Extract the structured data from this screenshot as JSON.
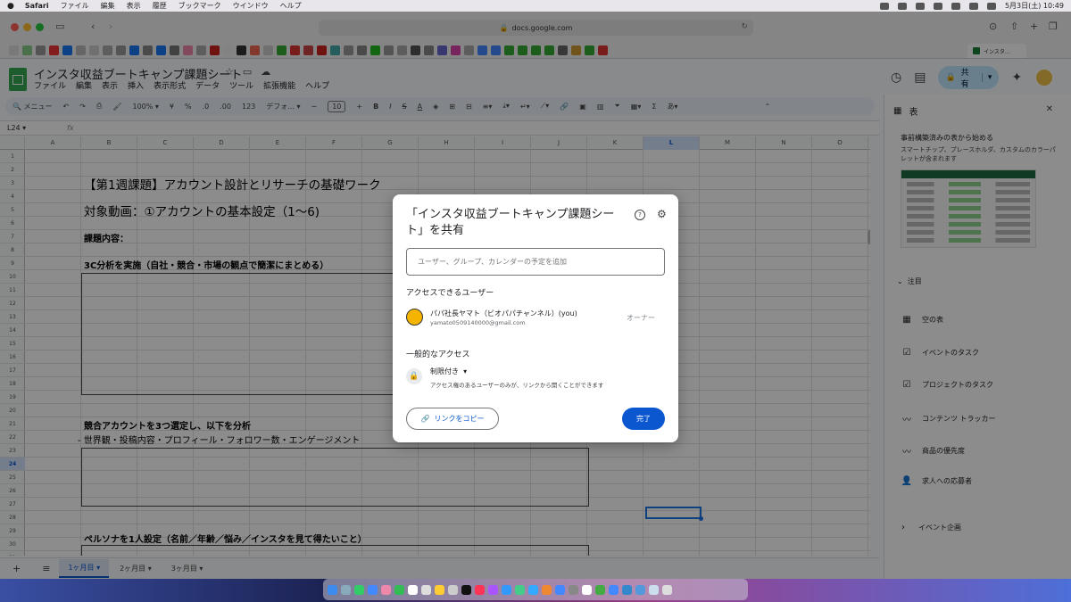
{
  "menubar": {
    "app": "Safari",
    "items": [
      "ファイル",
      "編集",
      "表示",
      "履歴",
      "ブックマーク",
      "ウインドウ",
      "ヘルプ"
    ],
    "datetime": "5月3日(土) 10:49"
  },
  "safari": {
    "url": "docs.google.com",
    "active_tab": "インスタ…"
  },
  "sheets": {
    "title": "インスタ収益ブートキャンプ課題シート",
    "menus": [
      "ファイル",
      "編集",
      "表示",
      "挿入",
      "表示形式",
      "データ",
      "ツール",
      "拡張機能",
      "ヘルプ"
    ],
    "share_label": "共有",
    "toolbar": {
      "menu": "メニュー",
      "zoom": "100%",
      "yen": "¥",
      "percent": "%",
      "dec_dec": ".0",
      "dec_inc": ".00",
      "num_fmt": "123",
      "font": "デフォ...",
      "font_size": "10"
    },
    "name_box": "L24",
    "fx": "fx",
    "columns": [
      "A",
      "B",
      "C",
      "D",
      "E",
      "F",
      "G",
      "H",
      "I",
      "J",
      "K",
      "L",
      "M",
      "N",
      "O"
    ],
    "selected_col": "L",
    "selected_row": "24",
    "rows": [
      "1",
      "2",
      "3",
      "4",
      "5",
      "6",
      "7",
      "8",
      "9",
      "10",
      "11",
      "12",
      "13",
      "14",
      "15",
      "16",
      "17",
      "18",
      "19",
      "20",
      "21",
      "22",
      "23",
      "24",
      "25",
      "26",
      "27",
      "28",
      "29",
      "30",
      "31"
    ],
    "cells": {
      "heading": "【第1週課題】アカウント設計とリサーチの基礎ワーク",
      "video": "対象動画：①アカウントの基本設定（1〜6)",
      "task": "課題内容：",
      "c3": "3C分析を実施（自社・競合・市場の観点で簡潔にまとめる）",
      "competitor": "競合アカウントを3つ選定し、以下を分析",
      "competitor_detail": "- 世界観・投稿内容・プロフィール・フォロワー数・エンゲージメント",
      "persona": "ペルソナを1人設定（名前／年齢／悩み／インスタを見て得たいこと）"
    },
    "sheet_tabs": [
      "1ヶ月目",
      "2ヶ月目",
      "3ヶ月目"
    ],
    "active_sheet": "1ヶ月目"
  },
  "panel": {
    "title": "表",
    "heading": "事前構築済みの表から始める",
    "description": "スマートチップ、プレースホルダ、カスタムのカラーパレットが含まれます",
    "section": "注目",
    "items": [
      "空の表",
      "イベントのタスク",
      "プロジェクトのタスク",
      "コンテンツ トラッカー",
      "商品の優先度",
      "求人への応募者"
    ],
    "section2": "イベント企画"
  },
  "dialog": {
    "title": "「インスタ収益ブートキャンプ課題シート」を共有",
    "help_icon": "?",
    "input_placeholder": "ユーザー、グループ、カレンダーの予定を追加",
    "people_header": "アクセスできるユーザー",
    "user_name": "パパ社長ヤマト（ビオパパチャンネル）(you)",
    "user_email": "yamato0509140000@gmail.com",
    "user_role": "オーナー",
    "general_header": "一般的なアクセス",
    "access_value": "制限付き",
    "access_desc": "アクセス権のあるユーザーのみが、リンクから開くことができます",
    "copy_link": "リンクをコピー",
    "done": "完了"
  },
  "colors": {
    "accent": "#0b57d0",
    "share_bg": "#c2e7ff",
    "sheets_green": "#34a853"
  }
}
